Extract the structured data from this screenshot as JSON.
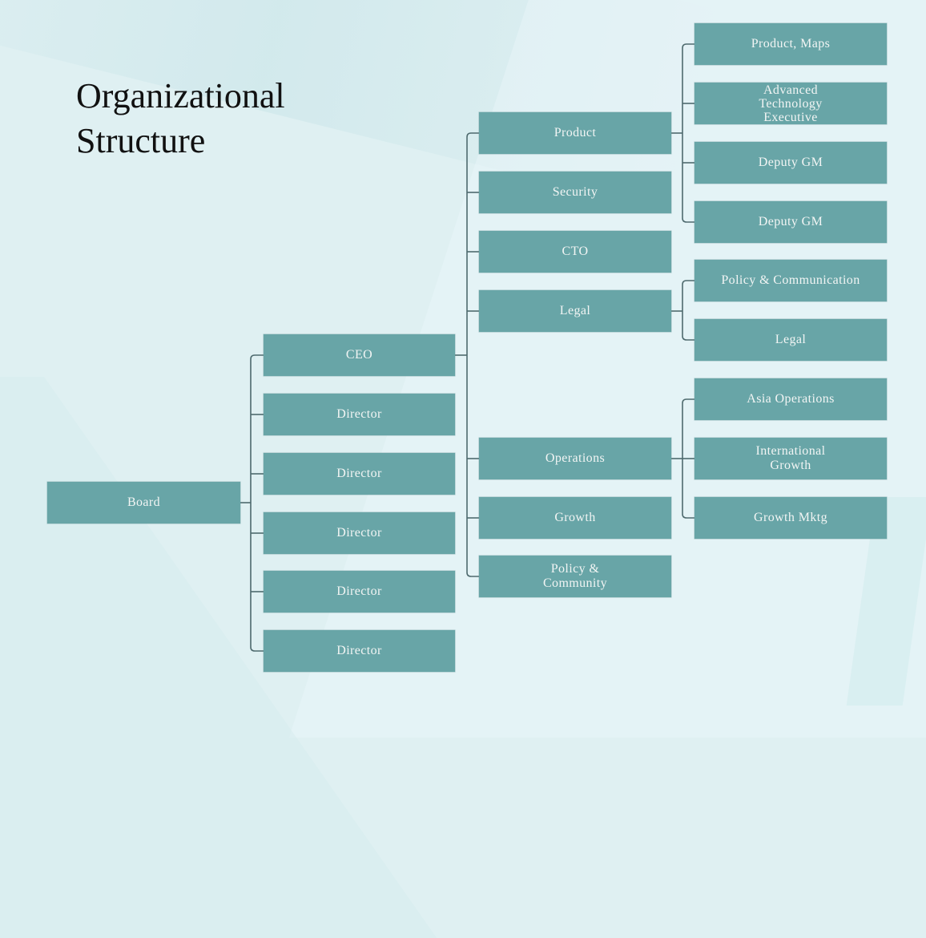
{
  "title": {
    "line1": "Organizational",
    "line2": "Structure"
  },
  "colors": {
    "node_fill": "#68a5a7",
    "node_text": "#f2f5f4",
    "connector": "#4e6a6e",
    "background": "#dff0f2",
    "title_text": "#111111"
  },
  "org_chart": {
    "root": {
      "label": "Board"
    },
    "level1": [
      {
        "label": "CEO"
      },
      {
        "label": "Director"
      },
      {
        "label": "Director"
      },
      {
        "label": "Director"
      },
      {
        "label": "Director"
      },
      {
        "label": "Director"
      }
    ],
    "level2": [
      {
        "label": "Product"
      },
      {
        "label": "Security"
      },
      {
        "label": "CTO"
      },
      {
        "label": "Legal"
      },
      {
        "label": "Operations"
      },
      {
        "label": "Growth"
      },
      {
        "label": "Policy & Community"
      }
    ],
    "level3": [
      {
        "label": "Product, Maps",
        "parent": "Product"
      },
      {
        "label": "Advanced Technology Executive",
        "parent": "Product"
      },
      {
        "label": "Deputy GM",
        "parent": "Product"
      },
      {
        "label": "Deputy GM",
        "parent": "Product"
      },
      {
        "label": "Policy & Communication",
        "parent": "Legal"
      },
      {
        "label": "Legal",
        "parent": "Legal"
      },
      {
        "label": "Asia Operations",
        "parent": "Operations"
      },
      {
        "label": "International Growth",
        "parent": "Operations"
      },
      {
        "label": "Growth Mktg",
        "parent": "Operations"
      }
    ]
  }
}
